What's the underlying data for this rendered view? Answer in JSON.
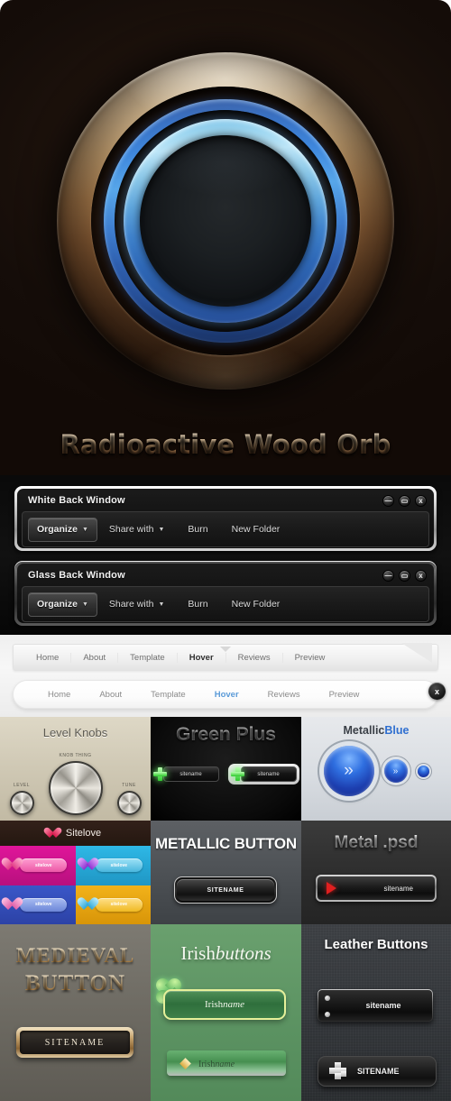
{
  "hero": {
    "title": "Radioactive Wood Orb"
  },
  "windows": [
    {
      "title": "White Back Window",
      "controls": {
        "minimize": "—",
        "maximize": "▭",
        "close": "x"
      },
      "toolbar": {
        "organize": "Organize",
        "caret": "▼",
        "share": "Share with",
        "burn": "Burn",
        "new_folder": "New Folder"
      }
    },
    {
      "title": "Glass Back Window",
      "controls": {
        "minimize": "—",
        "maximize": "▭",
        "close": "x"
      },
      "toolbar": {
        "organize": "Organize",
        "caret": "▼",
        "share": "Share with",
        "burn": "Burn",
        "new_folder": "New Folder"
      }
    }
  ],
  "navs": {
    "bar1": {
      "items": [
        "Home",
        "About",
        "Template",
        "Hover",
        "Reviews",
        "Preview"
      ],
      "active": "Hover"
    },
    "bar2": {
      "items": [
        "Home",
        "About",
        "Template",
        "Hover",
        "Reviews",
        "Preview"
      ],
      "active": "Hover",
      "close_label": "x"
    }
  },
  "grid": {
    "level_knobs": {
      "title": "Level Knobs",
      "labels": {
        "left": "LEVEL",
        "center": "KNOB THING",
        "right": "TUNE"
      }
    },
    "green_plus": {
      "title": "Green Plus",
      "buttons": [
        "sitename",
        "sitename"
      ],
      "icon": "plus-icon"
    },
    "metallic_blue": {
      "title_part1": "Metallic",
      "title_part2": "Blue",
      "accent": "#2f6fd0",
      "chevron": "»"
    },
    "sitelove": {
      "title": "Sitelove",
      "icon": "heart-icon",
      "quadrants": [
        {
          "color": "#e0159a",
          "label": "sitelove"
        },
        {
          "color": "#2eb8e6",
          "label": "sitelove"
        },
        {
          "color": "#3a57c8",
          "label": "sitelove"
        },
        {
          "color": "#f2b21a",
          "label": "sitelove"
        }
      ]
    },
    "metallic_button": {
      "title": "METALLIC BUTTON",
      "button_label": "SITENAME"
    },
    "metal_psd": {
      "title": "Metal .psd",
      "button_label": "sitename",
      "icon": "play-triangle-icon"
    },
    "medieval": {
      "line1": "MEDIEVAL",
      "line2": "BUTTON",
      "button_label": "SITENAME"
    },
    "irish": {
      "title_part1": "Irish",
      "title_part2": "buttons",
      "button1_part1": "Irish",
      "button1_part2": "name",
      "button2_part1": "Irish",
      "button2_part2": "name",
      "icon1": "clover-icon",
      "icon2": "diamond-icon"
    },
    "leather": {
      "title": "Leather Buttons",
      "button1_label": "sitename",
      "button2_label": "SITENAME",
      "icon": "cross-plus-icon"
    }
  }
}
